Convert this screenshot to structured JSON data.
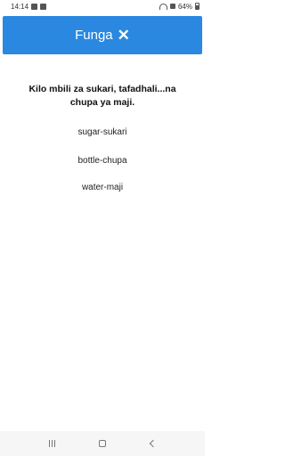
{
  "status_bar": {
    "time": "14:14",
    "battery": "64%"
  },
  "close_button": {
    "label": "Funga",
    "icon": "✕"
  },
  "prompt": "Kilo mbili za sukari, tafadhali...na chupa ya maji.",
  "word_pairs": [
    "sugar-sukari",
    "bottle-chupa",
    "water-maji"
  ],
  "colors": {
    "accent": "#2a88e0"
  }
}
